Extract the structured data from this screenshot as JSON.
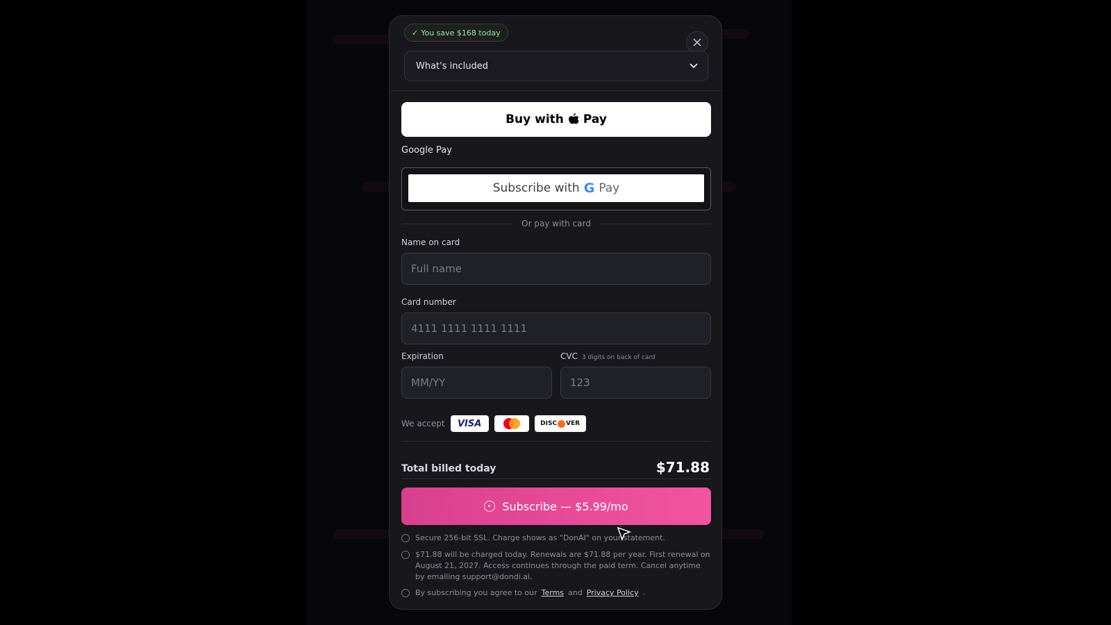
{
  "badge": {
    "text": "You save $168 today",
    "check": "✓"
  },
  "included": {
    "label": "What's included"
  },
  "apple_pay": {
    "prefix": "Buy with",
    "suffix": "Pay"
  },
  "google_pay": {
    "section_label": "Google Pay",
    "prefix": "Subscribe with",
    "g": "G",
    "suffix": "Pay"
  },
  "divider": {
    "text": "Or pay with card"
  },
  "form": {
    "name_label": "Name on card",
    "name_placeholder": "Full name",
    "card_label": "Card number",
    "card_placeholder": "4111 1111 1111 1111",
    "exp_label": "Expiration",
    "exp_placeholder": "MM/YY",
    "cvc_label": "CVC",
    "cvc_hint": "3 digits on back of card",
    "cvc_placeholder": "123"
  },
  "accept": {
    "label": "We accept",
    "visa": "VISA",
    "discover_left": "DISC",
    "discover_right": "VER"
  },
  "total": {
    "label": "Total billed today",
    "value": "$71.88"
  },
  "subscribe": {
    "label": "Subscribe — $5.99/mo"
  },
  "notes": {
    "secure": "Secure 256-bit SSL. Charge shows as \"DonAI\" on your statement.",
    "renewal": "$71.88 will be charged today. Renewals are $71.88 per year. First renewal on August 21, 2027. Access continues through the paid term. Cancel anytime by emailing support@dondi.ai.",
    "agree_prefix": "By subscribing you agree to our",
    "terms": "Terms",
    "and": "and",
    "privacy": "Privacy Policy",
    "period": "."
  },
  "colors": {
    "accent": "#f0529c",
    "success": "#9be3a8",
    "modal_bg": "#17171c"
  }
}
